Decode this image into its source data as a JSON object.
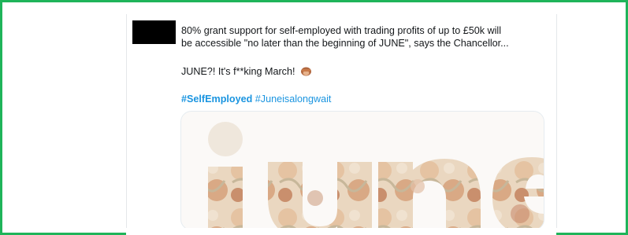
{
  "tweet": {
    "line1": "80% grant support for self-employed with trading profits of up to £50k will",
    "line2": "be accessible \"no later than the beginning of JUNE\", says the Chancellor...",
    "line3": "JUNE?! It's f**king March!",
    "hashtag_1": "#SelfEmployed",
    "hashtag_2": "#Juneisalongwait",
    "emoji": "see-no-evil-icon"
  },
  "media": {
    "image_text": "june"
  },
  "colors": {
    "border": "#1fb45a",
    "link": "#1b95e0",
    "text": "#14171a"
  }
}
